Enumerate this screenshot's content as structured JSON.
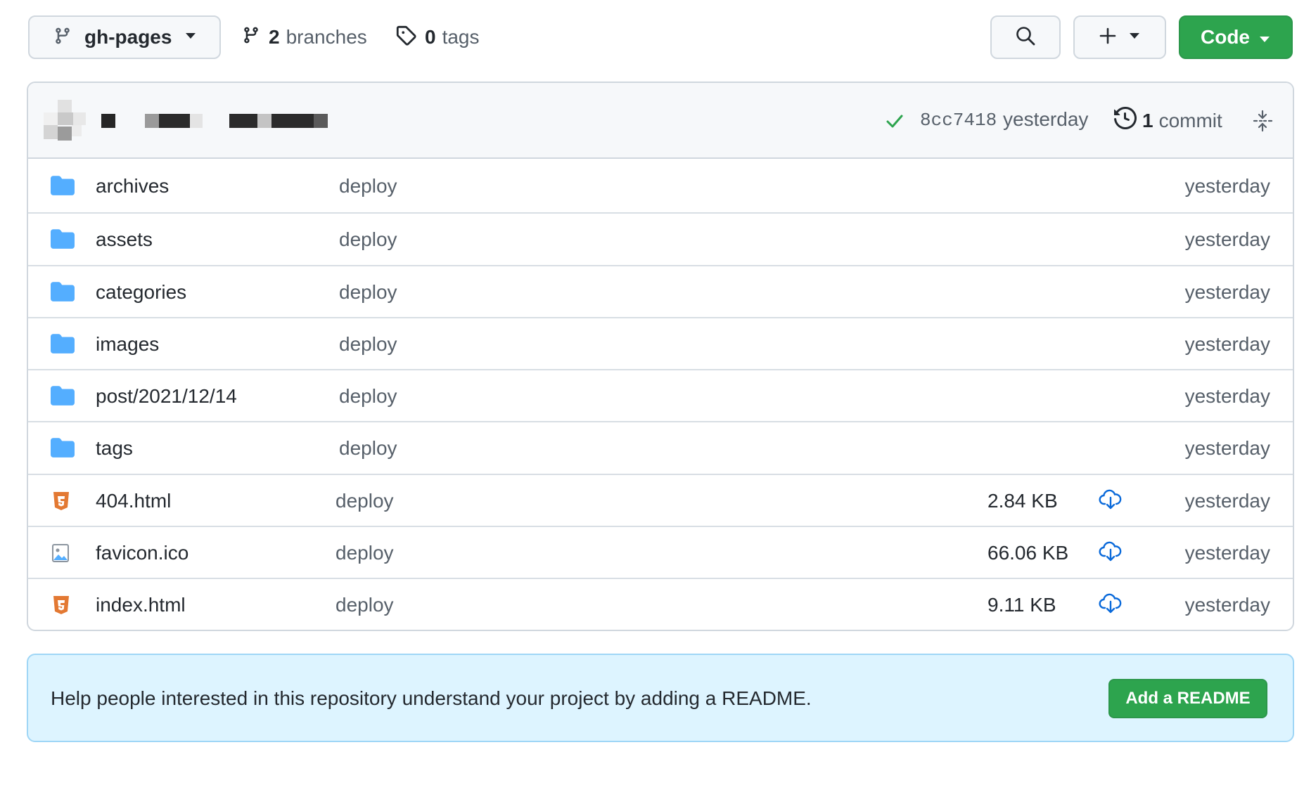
{
  "toolbar": {
    "branch_name": "gh-pages",
    "branches_count": "2",
    "branches_label": "branches",
    "tags_count": "0",
    "tags_label": "tags",
    "code_label": "Code"
  },
  "commit_bar": {
    "sha": "8cc7418",
    "age": "yesterday",
    "commits_count": "1",
    "commits_label": "commit"
  },
  "files": [
    {
      "name": "archives",
      "type": "folder",
      "message": "deploy",
      "size": "",
      "age": "yesterday"
    },
    {
      "name": "assets",
      "type": "folder",
      "message": "deploy",
      "size": "",
      "age": "yesterday"
    },
    {
      "name": "categories",
      "type": "folder",
      "message": "deploy",
      "size": "",
      "age": "yesterday"
    },
    {
      "name": "images",
      "type": "folder",
      "message": "deploy",
      "size": "",
      "age": "yesterday"
    },
    {
      "name": "post/2021/12/14",
      "type": "folder",
      "message": "deploy",
      "size": "",
      "age": "yesterday"
    },
    {
      "name": "tags",
      "type": "folder",
      "message": "deploy",
      "size": "",
      "age": "yesterday"
    },
    {
      "name": "404.html",
      "type": "html",
      "message": "deploy",
      "size": "2.84 KB",
      "age": "yesterday"
    },
    {
      "name": "favicon.ico",
      "type": "image",
      "message": "deploy",
      "size": "66.06 KB",
      "age": "yesterday"
    },
    {
      "name": "index.html",
      "type": "html",
      "message": "deploy",
      "size": "9.11 KB",
      "age": "yesterday"
    }
  ],
  "readme_banner": {
    "message": "Help people interested in this repository understand your project by adding a README.",
    "button_label": "Add a README"
  },
  "colors": {
    "folder": "#54aeff",
    "html": "#e37933",
    "image": "#57606a",
    "download": "#0969da",
    "success": "#2da44e"
  }
}
